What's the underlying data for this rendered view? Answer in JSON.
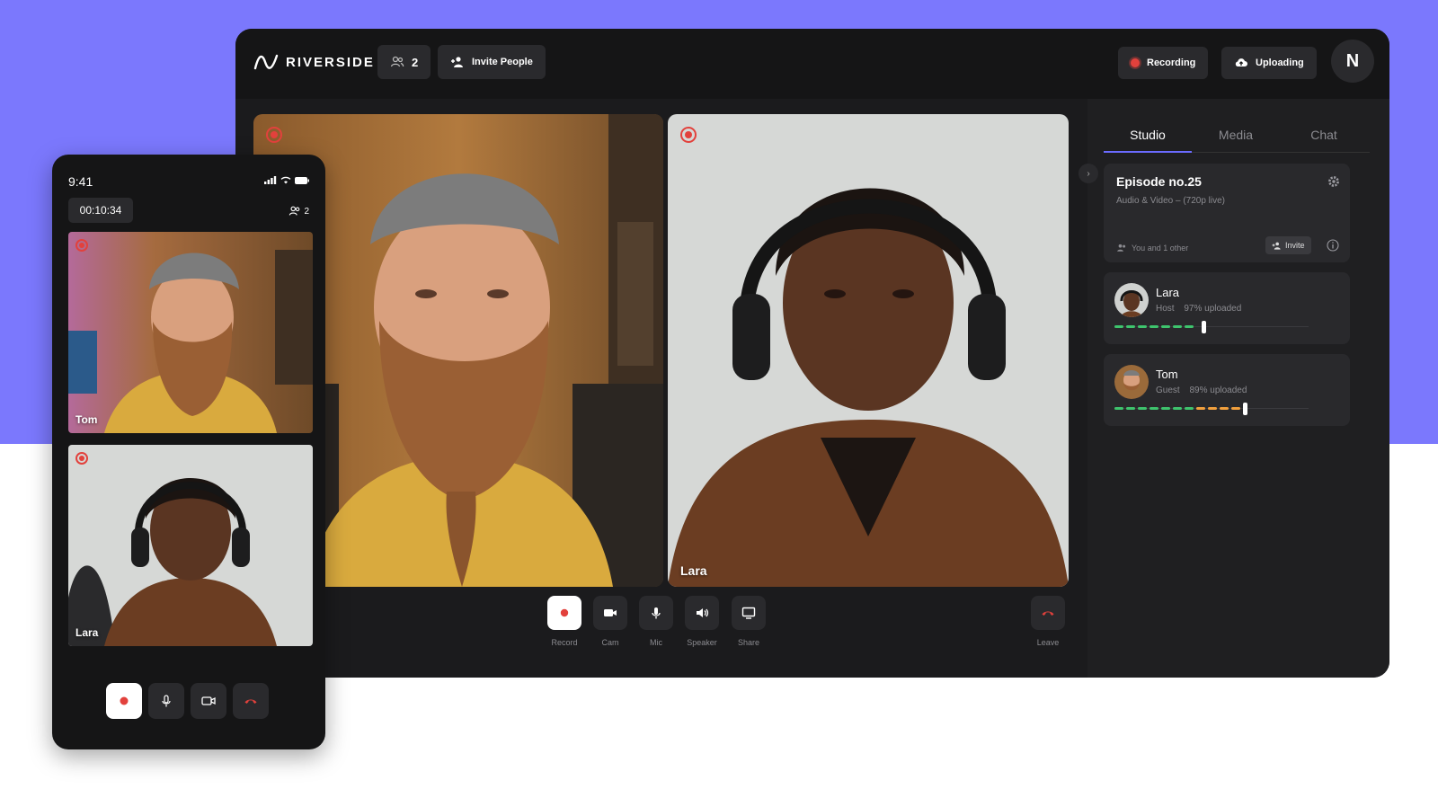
{
  "app": {
    "logo_text": "RIVERSIDE",
    "participants_count": "2",
    "invite_label": "Invite People",
    "recording_label": "Recording",
    "uploading_label": "Uploading",
    "avatar_initial": "N"
  },
  "stage": {
    "tiles": [
      {
        "name": ""
      },
      {
        "name": "Lara"
      }
    ]
  },
  "controls": {
    "record": "Record",
    "cam": "Cam",
    "mic": "Mic",
    "speaker": "Speaker",
    "share": "Share",
    "leave": "Leave"
  },
  "sidebar": {
    "tabs": [
      "Studio",
      "Media",
      "Chat"
    ],
    "active_tab": "Studio",
    "episode": {
      "title": "Episode no.25",
      "subtitle": "Audio & Video – (720p live)",
      "attendees": "You and 1 other",
      "invite_label": "Invite"
    },
    "participants": [
      {
        "name": "Lara",
        "role": "Host",
        "upload": "97% uploaded",
        "level": 0.45
      },
      {
        "name": "Tom",
        "role": "Guest",
        "upload": "89% uploaded",
        "level": 0.66
      }
    ]
  },
  "mobile": {
    "time": "9:41",
    "timer": "00:10:34",
    "participants_count": "2",
    "tiles": [
      {
        "name": "Tom"
      },
      {
        "name": "Lara"
      }
    ]
  },
  "colors": {
    "accent": "#7b78fd",
    "record_red": "#e2413c",
    "level_green": "#3ec46d",
    "level_orange": "#f2a03d"
  }
}
